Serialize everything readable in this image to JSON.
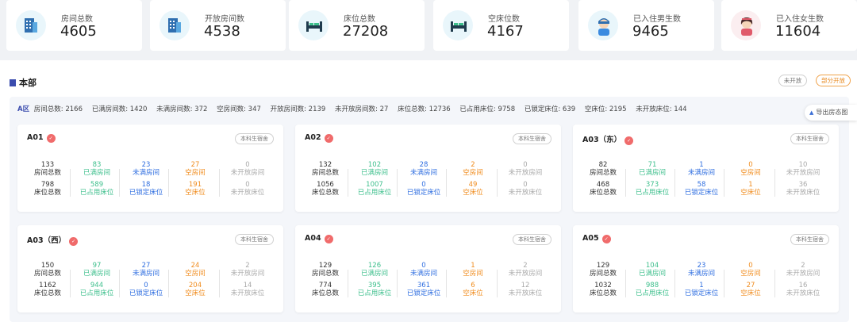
{
  "stats": [
    {
      "label": "房间总数",
      "value": "4605",
      "icon": "building-icon"
    },
    {
      "label": "开放房间数",
      "value": "4538",
      "icon": "building-icon"
    },
    {
      "label": "床位总数",
      "value": "27208",
      "icon": "bed-icon"
    },
    {
      "label": "空床位数",
      "value": "4167",
      "icon": "bed-icon"
    },
    {
      "label": "已入住男生数",
      "value": "9465",
      "icon": "male-student-icon"
    },
    {
      "label": "已入住女生数",
      "value": "11604",
      "icon": "female-student-icon"
    }
  ],
  "section": {
    "title": "本部",
    "filter_closed": "未开放",
    "filter_partial": "部分开放"
  },
  "zone": {
    "name": "A区",
    "summary": [
      "房间总数: 2166",
      "已满房间数: 1420",
      "未满房间数: 372",
      "空房间数: 347",
      "开放房间数: 2139",
      "未开放房间数: 27",
      "床位总数: 12736",
      "已占用床位: 9758",
      "已锁定床位: 639",
      "空床位: 2195",
      "未开放床位: 144"
    ],
    "export_label": "导出房态图"
  },
  "labels": {
    "row1": [
      "房间总数",
      "已满房间",
      "未满房间",
      "空房间",
      "未开放房间"
    ],
    "row2": [
      "床位总数",
      "已占用床位",
      "已锁定床位",
      "空床位",
      "未开放床位"
    ]
  },
  "buildings": [
    {
      "name": "A01",
      "tag": "本科生宿舍",
      "row1": [
        "133",
        "83",
        "23",
        "27",
        "0"
      ],
      "row2": [
        "798",
        "589",
        "18",
        "191",
        "0"
      ]
    },
    {
      "name": "A02",
      "tag": "本科生宿舍",
      "row1": [
        "132",
        "102",
        "28",
        "2",
        "0"
      ],
      "row2": [
        "1056",
        "1007",
        "0",
        "49",
        "0"
      ]
    },
    {
      "name": "A03（东）",
      "tag": "本科生宿舍",
      "row1": [
        "82",
        "71",
        "1",
        "0",
        "10"
      ],
      "row2": [
        "468",
        "373",
        "58",
        "1",
        "36"
      ]
    },
    {
      "name": "A03（西）",
      "tag": "本科生宿舍",
      "row1": [
        "150",
        "97",
        "27",
        "24",
        "2"
      ],
      "row2": [
        "1162",
        "944",
        "0",
        "204",
        "14"
      ]
    },
    {
      "name": "A04",
      "tag": "本科生宿舍",
      "row1": [
        "129",
        "126",
        "0",
        "1",
        "2"
      ],
      "row2": [
        "774",
        "395",
        "361",
        "6",
        "12"
      ]
    },
    {
      "name": "A05",
      "tag": "本科生宿舍",
      "row1": [
        "129",
        "104",
        "23",
        "0",
        "2"
      ],
      "row2": [
        "1032",
        "988",
        "1",
        "27",
        "16"
      ]
    }
  ],
  "colors": {
    "accent": "#3b4cae",
    "green": "#3dbf8c",
    "blue": "#2f6ee0",
    "orange": "#f08c1e",
    "gray": "#aaaaaa",
    "badge": "#f06b6b"
  }
}
